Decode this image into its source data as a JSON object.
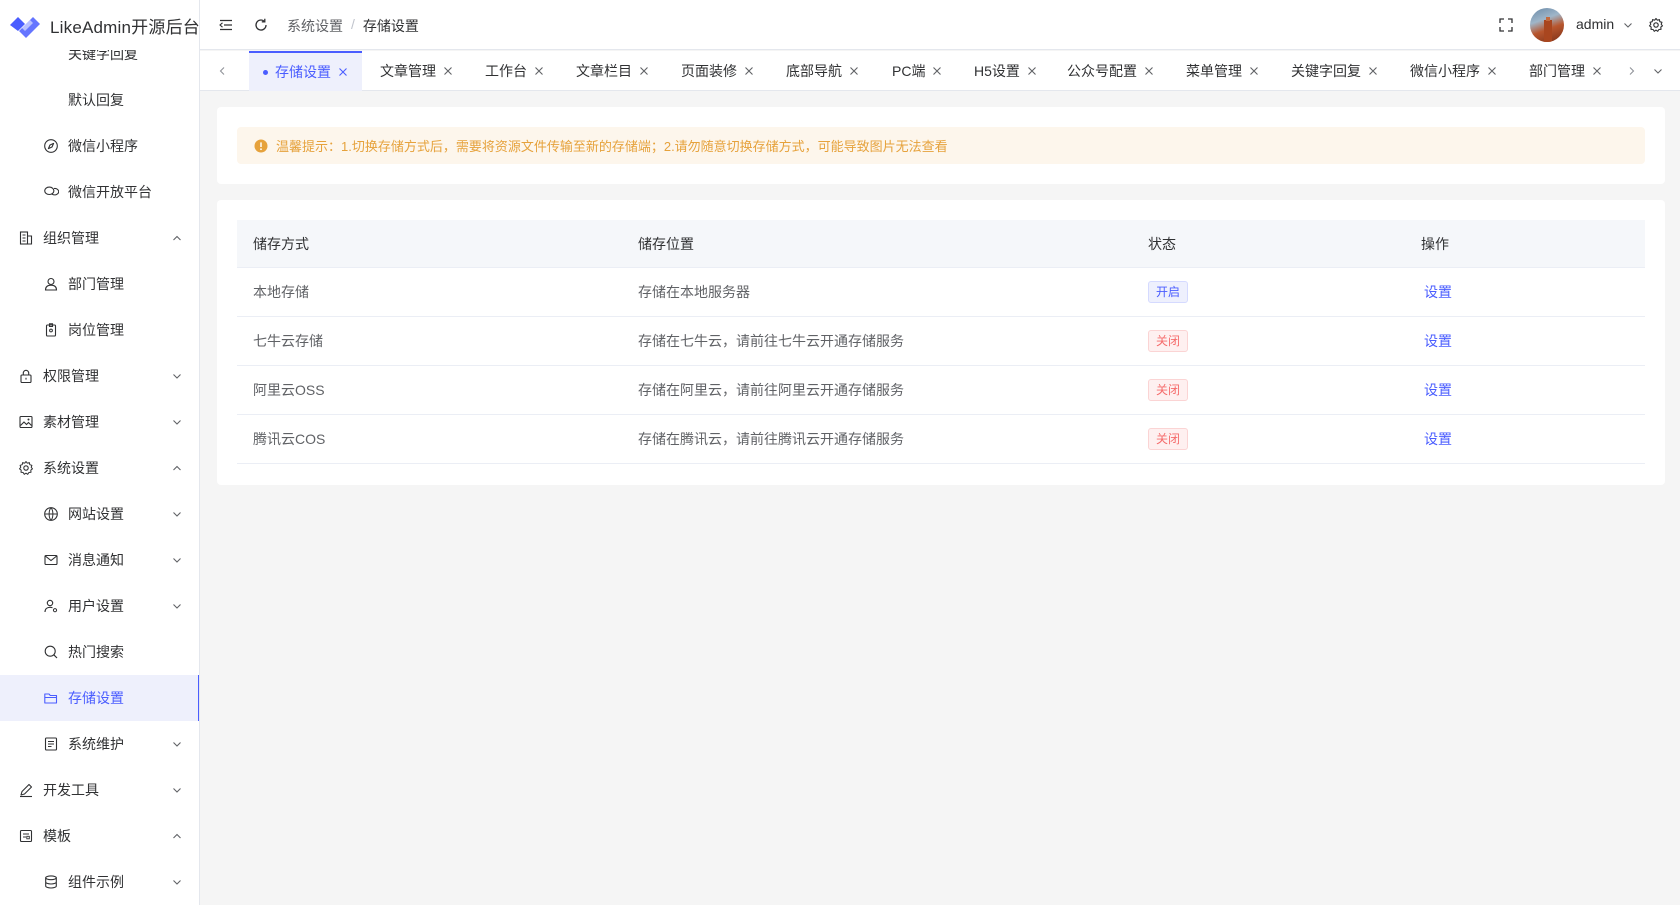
{
  "app": {
    "title": "LikeAdmin开源后台"
  },
  "sidebar": {
    "items": [
      {
        "label": "关键字回复",
        "level": 2,
        "icon": "none"
      },
      {
        "label": "默认回复",
        "level": 2,
        "icon": "none"
      },
      {
        "label": "微信小程序",
        "level": 2,
        "icon": "compass-icon"
      },
      {
        "label": "微信开放平台",
        "level": 2,
        "icon": "chat-icon"
      },
      {
        "label": "组织管理",
        "level": 1,
        "icon": "office-building-icon",
        "expanded": true
      },
      {
        "label": "部门管理",
        "level": 2,
        "icon": "user-icon"
      },
      {
        "label": "岗位管理",
        "level": 2,
        "icon": "badge-icon"
      },
      {
        "label": "权限管理",
        "level": 1,
        "icon": "lock-icon",
        "expanded": false
      },
      {
        "label": "素材管理",
        "level": 1,
        "icon": "picture-icon",
        "expanded": false
      },
      {
        "label": "系统设置",
        "level": 1,
        "icon": "gear-icon",
        "expanded": true
      },
      {
        "label": "网站设置",
        "level": 2,
        "icon": "globe-icon",
        "expanded": false
      },
      {
        "label": "消息通知",
        "level": 2,
        "icon": "message-icon",
        "expanded": false
      },
      {
        "label": "用户设置",
        "level": 2,
        "icon": "user-settings-icon",
        "expanded": false
      },
      {
        "label": "热门搜索",
        "level": 2,
        "icon": "search-icon"
      },
      {
        "label": "存储设置",
        "level": 2,
        "icon": "folder-icon",
        "active": true
      },
      {
        "label": "系统维护",
        "level": 2,
        "icon": "maintenance-icon",
        "expanded": false
      },
      {
        "label": "开发工具",
        "level": 1,
        "icon": "edit-pen-icon",
        "expanded": false
      },
      {
        "label": "模板",
        "level": 1,
        "icon": "template-icon",
        "expanded": true
      },
      {
        "label": "组件示例",
        "level": 2,
        "icon": "coin-stack-icon",
        "expanded": false
      }
    ]
  },
  "header": {
    "breadcrumb": [
      "系统设置",
      "存储设置"
    ],
    "breadcrumb_sep": "/",
    "user": "admin"
  },
  "tabs": [
    {
      "label": "存储设置",
      "active": true
    },
    {
      "label": "文章管理"
    },
    {
      "label": "工作台"
    },
    {
      "label": "文章栏目"
    },
    {
      "label": "页面装修"
    },
    {
      "label": "底部导航"
    },
    {
      "label": "PC端"
    },
    {
      "label": "H5设置"
    },
    {
      "label": "公众号配置"
    },
    {
      "label": "菜单管理"
    },
    {
      "label": "关键字回复"
    },
    {
      "label": "微信小程序"
    },
    {
      "label": "部门管理"
    }
  ],
  "alert": {
    "text": "温馨提示：1.切换存储方式后，需要将资源文件传输至新的存储端；2.请勿随意切换存储方式，可能导致图片无法查看"
  },
  "table": {
    "columns": [
      "储存方式",
      "储存位置",
      "状态",
      "操作"
    ],
    "rows": [
      {
        "method": "本地存储",
        "location": "存储在本地服务器",
        "status": "开启",
        "status_on": true,
        "action": "设置"
      },
      {
        "method": "七牛云存储",
        "location": "存储在七牛云，请前往七牛云开通存储服务",
        "status": "关闭",
        "status_on": false,
        "action": "设置"
      },
      {
        "method": "阿里云OSS",
        "location": "存储在阿里云，请前往阿里云开通存储服务",
        "status": "关闭",
        "status_on": false,
        "action": "设置"
      },
      {
        "method": "腾讯云COS",
        "location": "存储在腾讯云，请前往腾讯云开通存储服务",
        "status": "关闭",
        "status_on": false,
        "action": "设置"
      }
    ]
  },
  "colors": {
    "primary": "#4a5dff",
    "warning": "#e6a23c",
    "danger": "#f56c6c",
    "active_bg": "#eef0fc"
  }
}
